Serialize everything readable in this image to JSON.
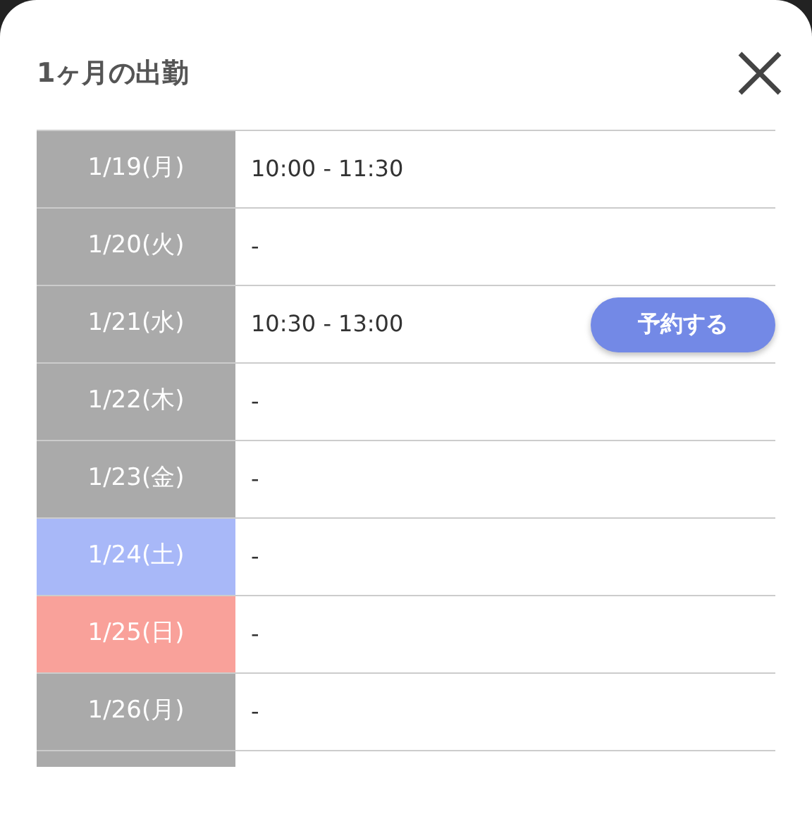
{
  "dialog": {
    "title": "1ヶ月の出勤",
    "rows": [
      {
        "date": "1/19(月)",
        "kind": "weekday",
        "time": "10:00 - 11:30"
      },
      {
        "date": "1/20(火)",
        "kind": "weekday",
        "time": "-"
      },
      {
        "date": "1/21(水)",
        "kind": "weekday",
        "time": "10:30 - 13:00",
        "button": "予約する"
      },
      {
        "date": "1/22(木)",
        "kind": "weekday",
        "time": "-"
      },
      {
        "date": "1/23(金)",
        "kind": "weekday",
        "time": "-"
      },
      {
        "date": "1/24(土)",
        "kind": "saturday",
        "time": "-"
      },
      {
        "date": "1/25(日)",
        "kind": "sunday",
        "time": "-"
      },
      {
        "date": "1/26(月)",
        "kind": "weekday",
        "time": "-"
      }
    ]
  }
}
